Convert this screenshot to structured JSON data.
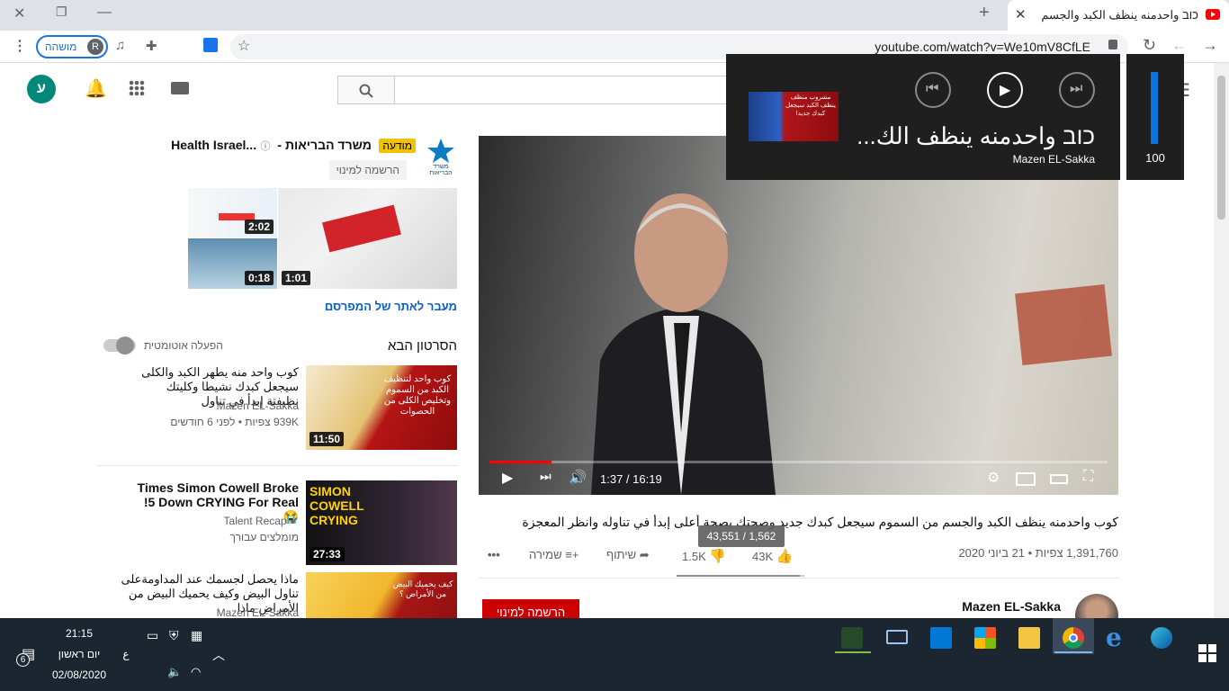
{
  "browser": {
    "tab_title": "כוב واحدمنه ينظف الكبد والجسم",
    "url": "youtube.com/watch?v=We10mV8CfLE",
    "profile_label": "מושהה",
    "profile_initial": "R"
  },
  "youtube": {
    "user_initial": "ע",
    "search_placeholder": "",
    "ad": {
      "badge": "מודעה",
      "channel": "משרד הבריאות - Health Israel...",
      "subscribe_label": "הרשמה למינוי",
      "visit_label": "מעבר לאתר של המפרסם",
      "logo_text": "משרד הבריאות",
      "thumbs": [
        {
          "duration": "2:02"
        },
        {
          "duration": "1:01"
        },
        {
          "duration": "0:18"
        }
      ]
    },
    "upnext": {
      "header": "הסרטון הבא",
      "autoplay_label": "הפעלה אוטומטית"
    },
    "recommendations": [
      {
        "title": "كوب واحد منه يطهر الكبد والكلى سيجعل كبدك نشيطا وكليتك نظيفتة إبدأ في تناول",
        "channel": "Mazen EL-Sakka",
        "meta": "939K צפיות • לפני 6 חודשים",
        "duration": "11:50",
        "thumb_text": "كوب واحد لتنظيف الكبد من السموم وتخليص الكلى من الحصوات"
      },
      {
        "title": "Times Simon Cowell Broke 5 Down CRYING For Real! 😭",
        "channel": "Talent Recap",
        "meta": "מומלצים עבורך",
        "duration": "27:33",
        "thumb_text": "SIMON COWELL CRYING"
      },
      {
        "title": "ماذا يحصل لجسمك عند المداومةعلى تناول البيض وكيف يحميك البيض من الأمراض ماذا",
        "channel": "Mazen EL-Sakka",
        "meta": "",
        "duration": "",
        "thumb_text": "كيف يحميك البيض من الأمراض ؟"
      }
    ],
    "video": {
      "title": "كوب واحدمنه ينظف الكبد والجسم من السموم سيجعل كبدك جديد وصحتك بصحة أعلى إبدأ في تناوله وانظر المعجزة",
      "views": "1,391,760 צפיות",
      "date": "21 ביוני 2020",
      "likes": "43K",
      "dislikes": "1.5K",
      "share_label": "שיתוף",
      "save_label": "שמירה",
      "more_label": "•••",
      "tooltip": "43,551 / 1,562",
      "time": "1:37 / 16:19",
      "progress": 0.1,
      "like_ratio": 0.965,
      "channel": "Mazen EL-Sakka",
      "subscribe_label": "הרשמה למינוי"
    }
  },
  "media_overlay": {
    "title": "כוב واحدمنه ينظف الك...",
    "artist": "Mazen EL-Sakka",
    "volume": "100",
    "volume_level": 1.0,
    "thumb_text": "مشروب منظف ينظف الكبد سيجعل كبدك جديدا"
  },
  "taskbar": {
    "time": "21:15",
    "day": "יום ראשון",
    "date": "02/08/2020",
    "lang": "ع",
    "notif_count": "6"
  },
  "colors": {
    "youtube_red": "#ff0000",
    "subscribe_red": "#cc0000",
    "link_blue": "#065fd4",
    "ad_badge": "#f2c100",
    "avatar_green": "#00897b"
  }
}
